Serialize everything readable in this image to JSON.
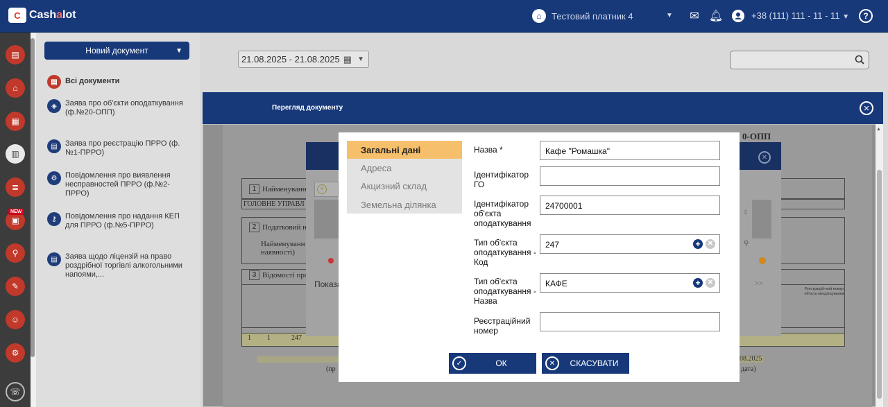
{
  "topbar": {
    "logo_text": "Cash",
    "logo_text_accent": "a",
    "logo_text_end": "lot",
    "payer": "Тестовий платник 4",
    "phone": "+38 (111) 111 - 11 - 11",
    "icons": [
      "home-icon",
      "mail-icon",
      "bell-icon",
      "user-icon",
      "help-icon"
    ]
  },
  "rail": {
    "new_badge": "NEW"
  },
  "sidebar": {
    "new_document_label": "Новий документ",
    "items": [
      {
        "label": "Всі документи",
        "icon": "all-documents-icon"
      },
      {
        "label": "Заява про об'єкти оподаткування (ф.№20-ОПП)",
        "icon": "objects-icon"
      },
      {
        "label": "Заява про реєстрацію ПРРО (ф.№1-ПРРО)",
        "icon": "document-icon"
      },
      {
        "label": "Повідомлення про виявлення несправностей ПРРО (ф.№2-ПРРО)",
        "icon": "gear-icon"
      },
      {
        "label": "Повідомлення про надання КЕП для ПРРО (ф.№5-ПРРО)",
        "icon": "key-icon"
      },
      {
        "label": "Заява щодо ліцензій на право роздрібної торгівлі алкогольними напоями,...",
        "icon": "document-icon"
      }
    ]
  },
  "filters": {
    "date_range": "21.08.2025 - 21.08.2025",
    "search_value": ""
  },
  "viewer": {
    "title": "Перегляд документу",
    "doc_fragments": {
      "header_right": "0-ОПП",
      "section1": "Найменуванн",
      "section1_num": "1",
      "org_line": "ГОЛОВНЕ УПРАВЛ",
      "section2": "Податковий н",
      "section2_num": "2",
      "section2_sub": "Найменуванн",
      "section2_sub2": "наявності)",
      "section3": "Відомості про",
      "section3_num": "3",
      "show_label": "Показа",
      "row_num": "1",
      "row_val1": "1",
      "row_val2": "247",
      "date_fragment": "08.2025",
      "sig_left": "(пр",
      "sig_right": "дата)",
      "pager": ">>",
      "col_right": "Реєстрацій-ний номер об'єкта оподаткування"
    }
  },
  "dialog": {
    "tabs": [
      {
        "label": "Загальні дані",
        "active": true
      },
      {
        "label": "Адреса",
        "active": false
      },
      {
        "label": "Акцизний склад",
        "active": false
      },
      {
        "label": "Земельна ділянка",
        "active": false
      }
    ],
    "fields": {
      "name_label": "Назва *",
      "name_value": "Кафе \"Ромашка\"",
      "go_id_label": "Ідентифікатор ГО",
      "go_id_value": "",
      "object_id_label": "Ідентифікатор об'єкта оподаткування",
      "object_id_value": "24700001",
      "type_code_label": "Тип об'єкта оподаткування - Код",
      "type_code_value": "247",
      "type_name_label": "Тип об'єкта оподаткування - Назва",
      "type_name_value": "КАФЕ",
      "reg_number_label": "Реєстраційний номер",
      "reg_number_value": ""
    },
    "ok_label": "ОК",
    "cancel_label": "СКАСУВАТИ"
  }
}
